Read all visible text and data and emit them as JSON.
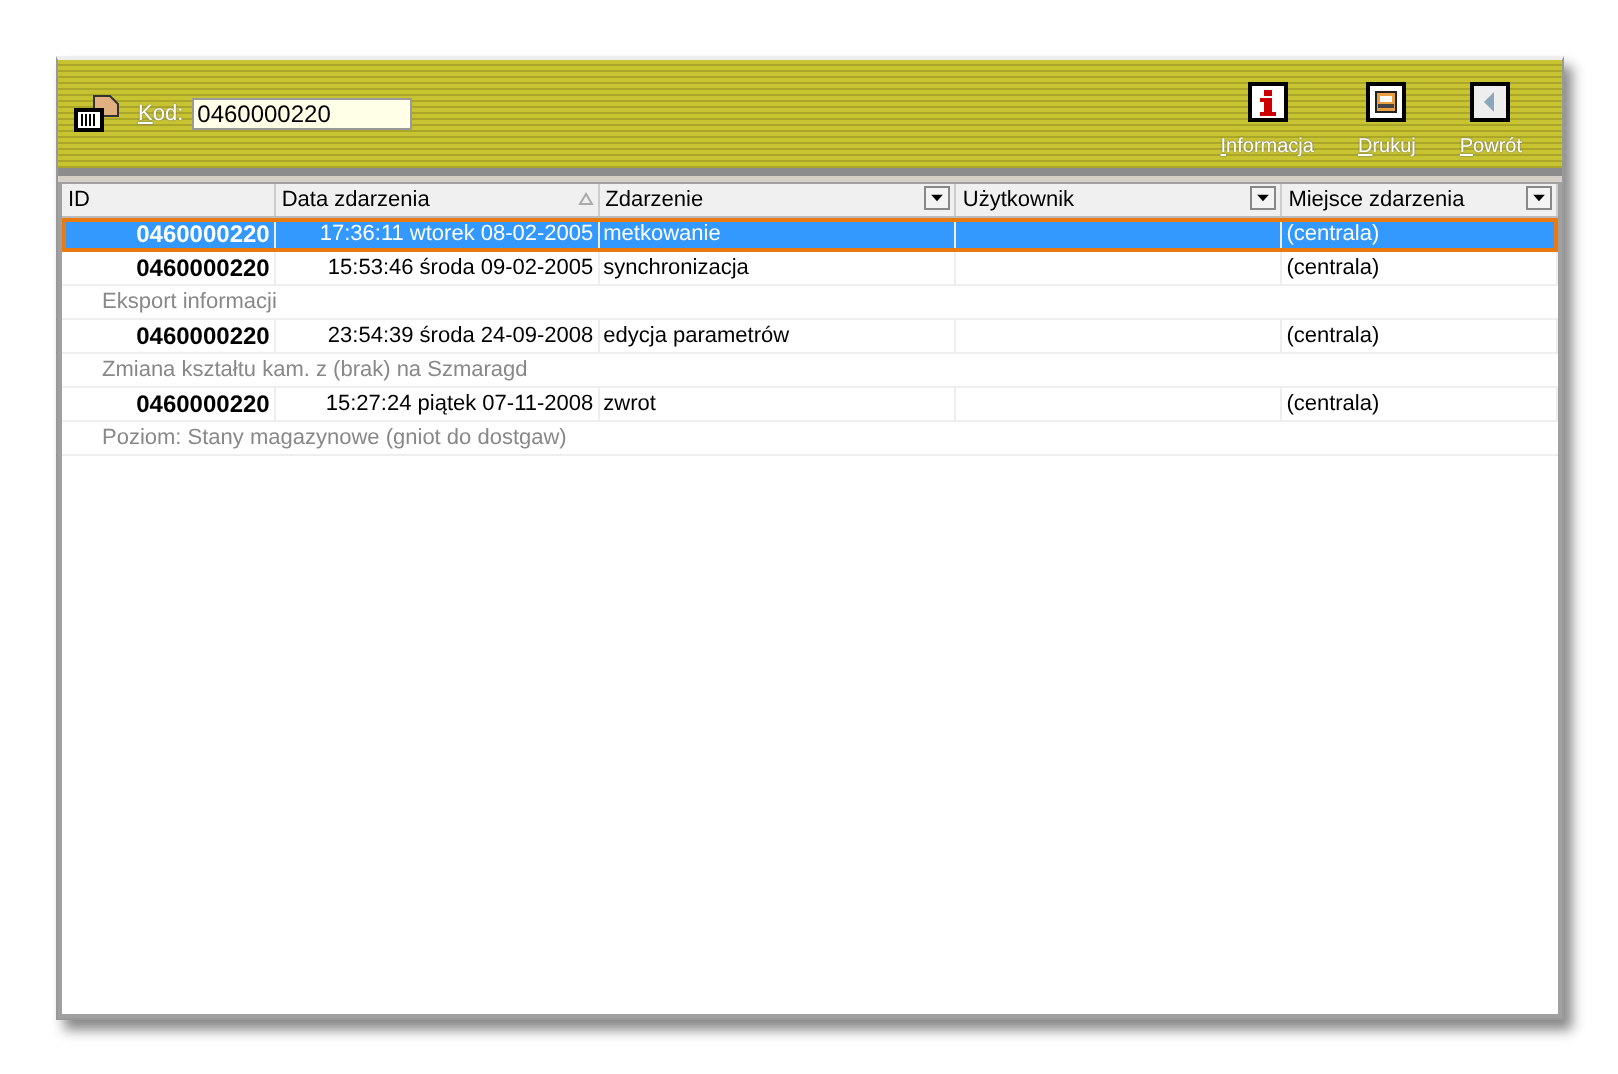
{
  "toolbar": {
    "code_label": "Kod:",
    "code_value": "0460000220",
    "buttons": [
      {
        "kind": "info",
        "label": "Informacja"
      },
      {
        "kind": "print",
        "label": "Drukuj"
      },
      {
        "kind": "back",
        "label": "Powrót"
      }
    ]
  },
  "table": {
    "columns": [
      {
        "label": "ID",
        "sorted": false,
        "filter": false
      },
      {
        "label": "Data zdarzenia",
        "sorted": true,
        "filter": false
      },
      {
        "label": "Zdarzenie",
        "sorted": false,
        "filter": true
      },
      {
        "label": "Użytkownik",
        "sorted": false,
        "filter": true
      },
      {
        "label": "Miejsce zdarzenia",
        "sorted": false,
        "filter": true
      }
    ],
    "rows": [
      {
        "id": "0460000220",
        "date": "17:36:11 wtorek 08-02-2005",
        "event": "metkowanie",
        "place": "(centrala)",
        "selected": true
      },
      {
        "id": "0460000220",
        "date": "15:53:46 środa 09-02-2005",
        "event": "synchronizacja",
        "place": "(centrala)",
        "selected": false,
        "note": "Eksport informacji"
      },
      {
        "id": "0460000220",
        "date": "23:54:39 środa 24-09-2008",
        "event": "edycja parametrów",
        "place": "(centrala)",
        "selected": false,
        "note": "Zmiana kształtu kam. z (brak) na Szmaragd"
      },
      {
        "id": "0460000220",
        "date": "15:27:24 piątek 07-11-2008",
        "event": "zwrot",
        "place": "(centrala)",
        "selected": false,
        "note": "Poziom: Stany magazynowe (gniot do dostgaw)"
      }
    ]
  }
}
